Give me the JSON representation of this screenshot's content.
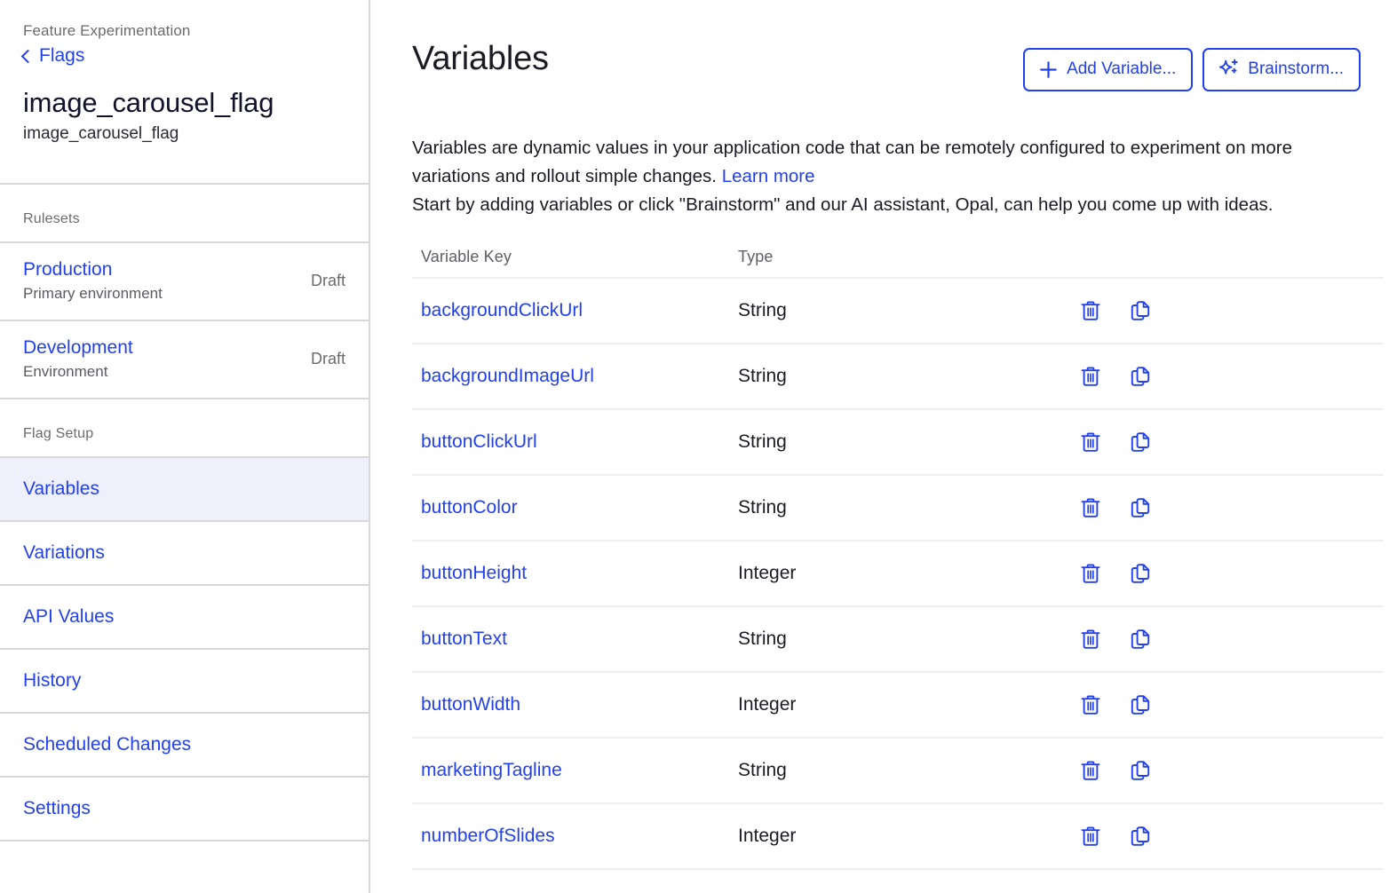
{
  "sidebar": {
    "product": "Feature Experimentation",
    "back_label": "Flags",
    "back_icon": "chevron-left-icon",
    "flag_title": "image_carousel_flag",
    "flag_key": "image_carousel_flag",
    "rulesets_label": "Rulesets",
    "rulesets": [
      {
        "name": "Production",
        "description": "Primary environment",
        "status": "Draft"
      },
      {
        "name": "Development",
        "description": "Environment",
        "status": "Draft"
      }
    ],
    "flag_setup_label": "Flag Setup",
    "nav_items": [
      {
        "label": "Variables",
        "active": true
      },
      {
        "label": "Variations",
        "active": false
      },
      {
        "label": "API Values",
        "active": false
      },
      {
        "label": "History",
        "active": false
      },
      {
        "label": "Scheduled Changes",
        "active": false
      },
      {
        "label": "Settings",
        "active": false
      }
    ]
  },
  "main": {
    "title": "Variables",
    "add_variable_label": "Add Variable...",
    "add_variable_icon": "plus-icon",
    "brainstorm_label": "Brainstorm...",
    "brainstorm_icon": "sparkle-ai-icon",
    "intro_line1": "Variables are dynamic values in your application code that can be remotely configured to experiment on more variations and rollout simple changes.",
    "intro_link": "Learn more",
    "intro_line2": "Start by adding variables or click \"Brainstorm\" and our AI assistant, Opal, can help you come up with ideas.",
    "table": {
      "columns": [
        "Variable Key",
        "Type"
      ],
      "row_actions": [
        "delete-icon",
        "duplicate-icon"
      ],
      "rows": [
        {
          "key": "backgroundClickUrl",
          "type": "String"
        },
        {
          "key": "backgroundImageUrl",
          "type": "String"
        },
        {
          "key": "buttonClickUrl",
          "type": "String"
        },
        {
          "key": "buttonColor",
          "type": "String"
        },
        {
          "key": "buttonHeight",
          "type": "Integer"
        },
        {
          "key": "buttonText",
          "type": "String"
        },
        {
          "key": "buttonWidth",
          "type": "Integer"
        },
        {
          "key": "marketingTagline",
          "type": "String"
        },
        {
          "key": "numberOfSlides",
          "type": "Integer"
        }
      ]
    }
  },
  "colors": {
    "accent_blue": "#2340ef",
    "active_nav_bg": "#eef0fc",
    "border_gray": "#d8d8d8",
    "row_border": "#eeeeee",
    "muted_text": "#6b6b6b"
  }
}
